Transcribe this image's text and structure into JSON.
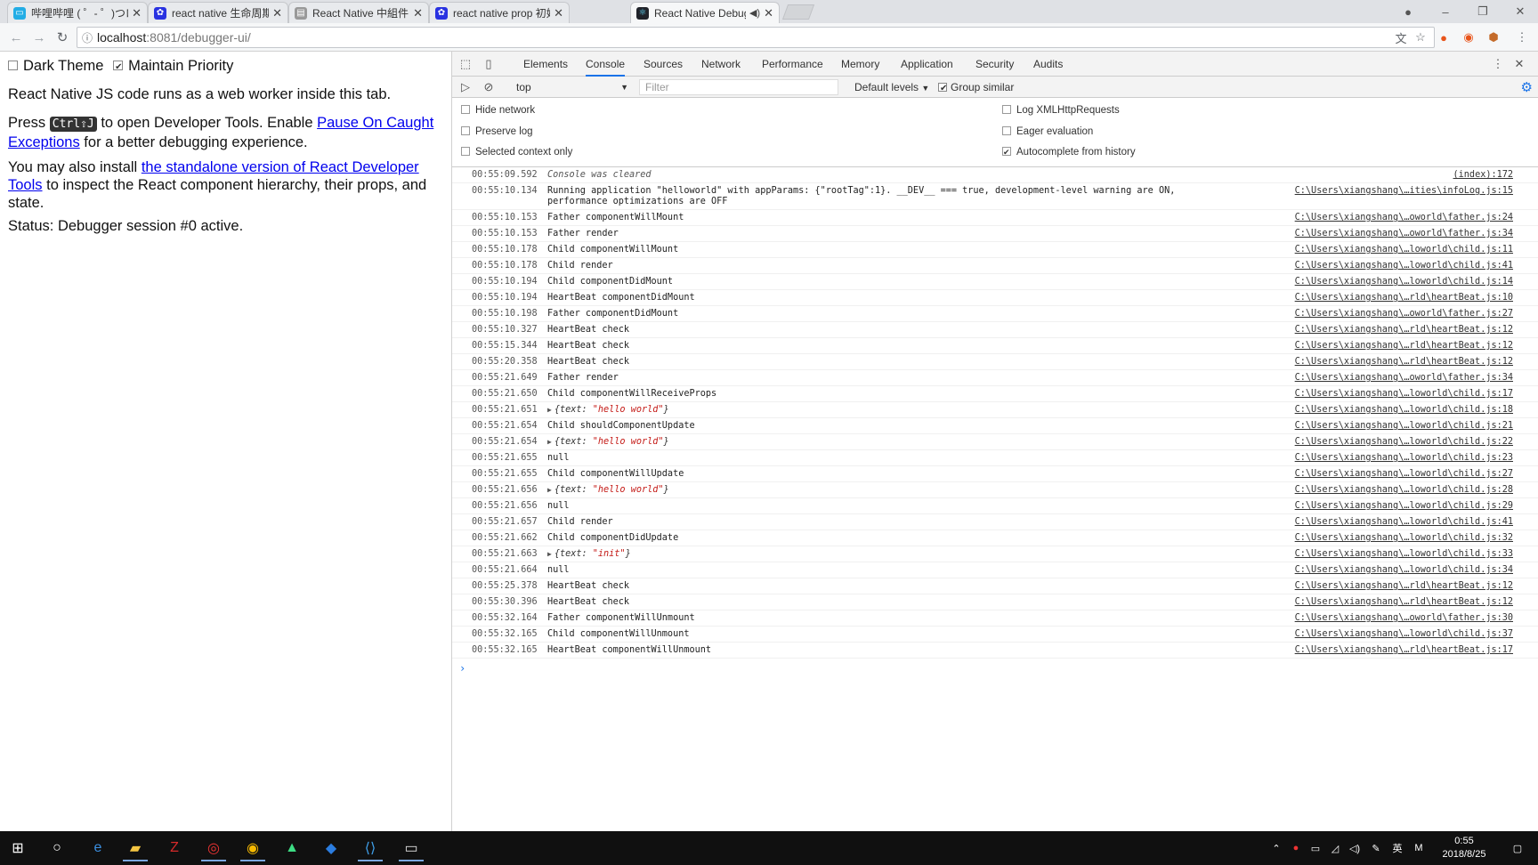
{
  "browser": {
    "tabs": [
      {
        "label": "哔哩哔哩 ( ゜- ゜)つロ 干杯",
        "icon": "bilibili-icon",
        "color": "#23ade5",
        "active": false
      },
      {
        "label": "react native 生命周期_百度",
        "icon": "baidu-paw-icon",
        "color": "#2932e1",
        "active": false
      },
      {
        "label": "React Native 中組件的生命",
        "icon": "document-icon",
        "color": "#888888",
        "active": false
      },
      {
        "label": "react native prop 初始值",
        "icon": "baidu-paw-icon",
        "color": "#2932e1",
        "active": false
      },
      {
        "label": "React Native Debug",
        "icon": "react-icon",
        "color": "#61dafb",
        "active": true
      }
    ],
    "address": {
      "host": "localhost",
      "path": ":8081/debugger-ui/"
    }
  },
  "page": {
    "dark_theme_label": "Dark Theme",
    "maintain_priority_label": "Maintain Priority",
    "line1": "React Native JS code runs as a web worker inside this tab.",
    "press": "Press",
    "shortcut": "Ctrl⇧J",
    "open_tools": " to open Developer Tools. Enable ",
    "pause_link": "Pause On Caught Exceptions",
    "better": " for a better debugging experience.",
    "install": "You may also install ",
    "standalone_link": "the standalone version of React Developer Tools",
    "inspect": " to inspect the React component hierarchy, their props, and state.",
    "status": "Status: Debugger session #0 active."
  },
  "devtools": {
    "tabs": [
      "Elements",
      "Console",
      "Sources",
      "Network",
      "Performance",
      "Memory",
      "Application",
      "Security",
      "Audits"
    ],
    "active_tab": "Console",
    "context": "top",
    "filter_placeholder": "Filter",
    "levels": "Default levels",
    "group_similar": "Group similar",
    "options": {
      "hide_network": "Hide network",
      "preserve_log": "Preserve log",
      "selected_context": "Selected context only",
      "log_xhr": "Log XMLHttpRequests",
      "eager_eval": "Eager evaluation",
      "autocomplete": "Autocomplete from history"
    }
  },
  "console": [
    {
      "ts": "00:55:09.592",
      "msg": "Console was cleared",
      "src": "(index):172",
      "kind": "italic"
    },
    {
      "ts": "00:55:10.134",
      "msg": "Running application \"helloworld\" with appParams: {\"rootTag\":1}. __DEV__ === true, development-level warning are ON,\nperformance optimizations are OFF",
      "src": "C:\\Users\\xiangshang\\…ities\\infoLog.js:15",
      "kind": "text"
    },
    {
      "ts": "00:55:10.153",
      "msg": "Father componentWillMount",
      "src": "C:\\Users\\xiangshang\\…oworld\\father.js:24",
      "kind": "text"
    },
    {
      "ts": "00:55:10.153",
      "msg": "Father render",
      "src": "C:\\Users\\xiangshang\\…oworld\\father.js:34",
      "kind": "text"
    },
    {
      "ts": "00:55:10.178",
      "msg": "Child componentWillMount",
      "src": "C:\\Users\\xiangshang\\…loworld\\child.js:11",
      "kind": "text"
    },
    {
      "ts": "00:55:10.178",
      "msg": "Child render",
      "src": "C:\\Users\\xiangshang\\…loworld\\child.js:41",
      "kind": "text"
    },
    {
      "ts": "00:55:10.194",
      "msg": "Child componentDidMount",
      "src": "C:\\Users\\xiangshang\\…loworld\\child.js:14",
      "kind": "text"
    },
    {
      "ts": "00:55:10.194",
      "msg": "HeartBeat componentDidMount",
      "src": "C:\\Users\\xiangshang\\…rld\\heartBeat.js:10",
      "kind": "text"
    },
    {
      "ts": "00:55:10.198",
      "msg": "Father componentDidMount",
      "src": "C:\\Users\\xiangshang\\…oworld\\father.js:27",
      "kind": "text"
    },
    {
      "ts": "00:55:10.327",
      "msg": "HeartBeat check",
      "src": "C:\\Users\\xiangshang\\…rld\\heartBeat.js:12",
      "kind": "text"
    },
    {
      "ts": "00:55:15.344",
      "msg": "HeartBeat check",
      "src": "C:\\Users\\xiangshang\\…rld\\heartBeat.js:12",
      "kind": "text"
    },
    {
      "ts": "00:55:20.358",
      "msg": "HeartBeat check",
      "src": "C:\\Users\\xiangshang\\…rld\\heartBeat.js:12",
      "kind": "text"
    },
    {
      "ts": "00:55:21.649",
      "msg": "Father render",
      "src": "C:\\Users\\xiangshang\\…oworld\\father.js:34",
      "kind": "text"
    },
    {
      "ts": "00:55:21.650",
      "msg": "Child componentWillReceiveProps",
      "src": "C:\\Users\\xiangshang\\…loworld\\child.js:17",
      "kind": "text"
    },
    {
      "ts": "00:55:21.651",
      "msg": "text: \"hello world\"",
      "key": "text",
      "val": "\"hello world\"",
      "src": "C:\\Users\\xiangshang\\…loworld\\child.js:18",
      "kind": "object"
    },
    {
      "ts": "00:55:21.654",
      "msg": "Child shouldComponentUpdate",
      "src": "C:\\Users\\xiangshang\\…loworld\\child.js:21",
      "kind": "text"
    },
    {
      "ts": "00:55:21.654",
      "msg": "text: \"hello world\"",
      "key": "text",
      "val": "\"hello world\"",
      "src": "C:\\Users\\xiangshang\\…loworld\\child.js:22",
      "kind": "object"
    },
    {
      "ts": "00:55:21.655",
      "msg": "null",
      "src": "C:\\Users\\xiangshang\\…loworld\\child.js:23",
      "kind": "text"
    },
    {
      "ts": "00:55:21.655",
      "msg": "Child componentWillUpdate",
      "src": "C:\\Users\\xiangshang\\…loworld\\child.js:27",
      "kind": "text"
    },
    {
      "ts": "00:55:21.656",
      "msg": "text: \"hello world\"",
      "key": "text",
      "val": "\"hello world\"",
      "src": "C:\\Users\\xiangshang\\…loworld\\child.js:28",
      "kind": "object"
    },
    {
      "ts": "00:55:21.656",
      "msg": "null",
      "src": "C:\\Users\\xiangshang\\…loworld\\child.js:29",
      "kind": "text"
    },
    {
      "ts": "00:55:21.657",
      "msg": "Child render",
      "src": "C:\\Users\\xiangshang\\…loworld\\child.js:41",
      "kind": "text"
    },
    {
      "ts": "00:55:21.662",
      "msg": "Child componentDidUpdate",
      "src": "C:\\Users\\xiangshang\\…loworld\\child.js:32",
      "kind": "text"
    },
    {
      "ts": "00:55:21.663",
      "msg": "text: \"init\"",
      "key": "text",
      "val": "\"init\"",
      "src": "C:\\Users\\xiangshang\\…loworld\\child.js:33",
      "kind": "object"
    },
    {
      "ts": "00:55:21.664",
      "msg": "null",
      "src": "C:\\Users\\xiangshang\\…loworld\\child.js:34",
      "kind": "text"
    },
    {
      "ts": "00:55:25.378",
      "msg": "HeartBeat check",
      "src": "C:\\Users\\xiangshang\\…rld\\heartBeat.js:12",
      "kind": "text"
    },
    {
      "ts": "00:55:30.396",
      "msg": "HeartBeat check",
      "src": "C:\\Users\\xiangshang\\…rld\\heartBeat.js:12",
      "kind": "text"
    },
    {
      "ts": "00:55:32.164",
      "msg": "Father componentWillUnmount",
      "src": "C:\\Users\\xiangshang\\…oworld\\father.js:30",
      "kind": "text"
    },
    {
      "ts": "00:55:32.165",
      "msg": "Child componentWillUnmount",
      "src": "C:\\Users\\xiangshang\\…loworld\\child.js:37",
      "kind": "text"
    },
    {
      "ts": "00:55:32.165",
      "msg": "HeartBeat componentWillUnmount",
      "src": "C:\\Users\\xiangshang\\…rld\\heartBeat.js:17",
      "kind": "text"
    }
  ],
  "taskbar": {
    "apps": [
      "start-icon",
      "cortana-icon",
      "edge-icon",
      "file-explorer-icon",
      "filezilla-icon",
      "netease-music-icon",
      "chrome-icon",
      "android-studio-icon",
      "sourcetree-icon",
      "vscode-icon",
      "terminal-icon"
    ],
    "ime": "英",
    "time": "0:55",
    "date": "2018/8/25"
  }
}
